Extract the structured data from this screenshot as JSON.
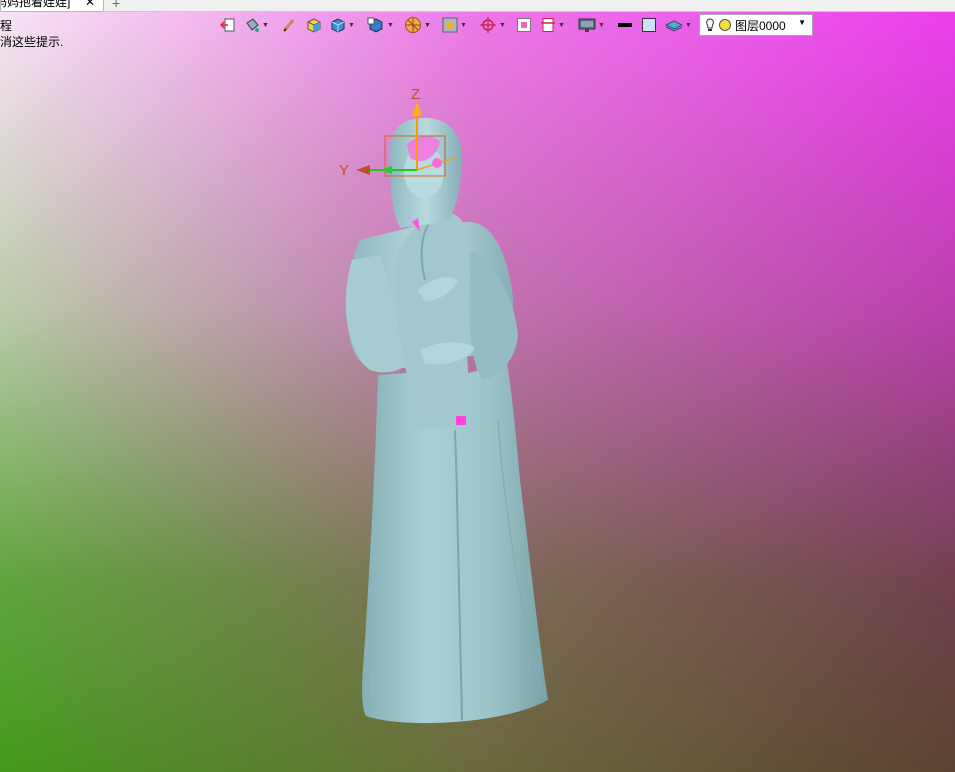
{
  "tab": {
    "title": "妈妈抱着娃娃]",
    "close": "✕",
    "new_tab": "+"
  },
  "hints": {
    "line1": "程",
    "line2": "消这些提示."
  },
  "toolbar": {
    "layer_label": "图层0000",
    "layer_arrow": "▼"
  },
  "axes": {
    "z": "Z",
    "y": "Y"
  },
  "colors": {
    "statue": "#9ec6cc",
    "statue_shade": "#7fa8af",
    "axis_z": "#ff9a00",
    "axis_y": "#1ec81e",
    "axis_label": "#c8501e",
    "pink_artifact": "#ff33dd"
  }
}
